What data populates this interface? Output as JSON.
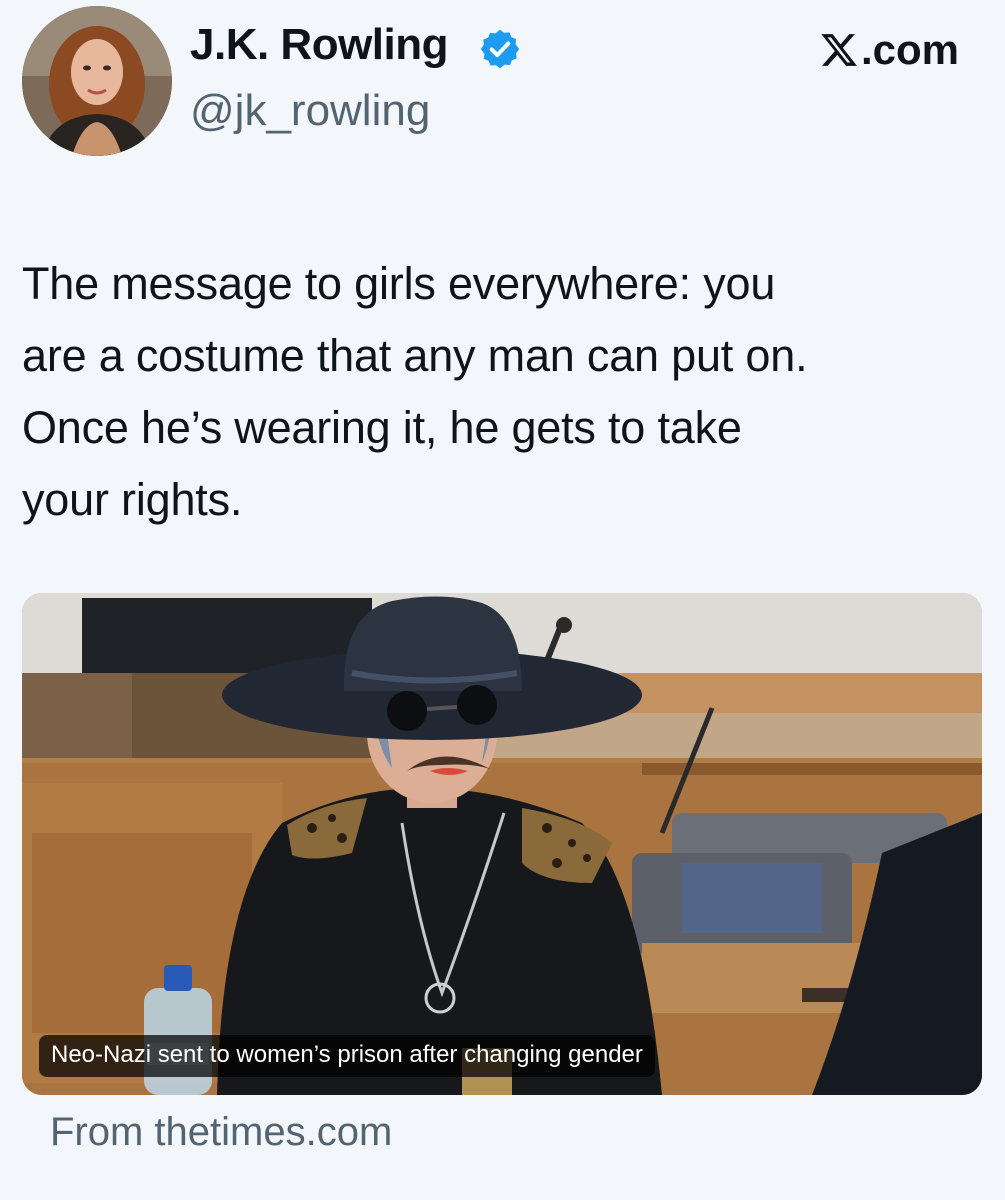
{
  "platform": {
    "label": ".com",
    "icon": "x-logo-icon"
  },
  "author": {
    "display_name": "J.K. Rowling",
    "handle": "@jk_rowling",
    "verified": true,
    "verified_color": "#1d9bf0",
    "avatar_icon": "avatar-photo"
  },
  "tweet": {
    "lines": [
      "The message to girls everywhere: you",
      "are a costume that any man can put on.",
      "Once he’s wearing it, he gets to take",
      "your rights."
    ]
  },
  "media": {
    "caption": "Neo-Nazi sent to women’s prison after changing gender",
    "source": "From thetimes.com"
  },
  "colors": {
    "background": "#f3f7fc",
    "text": "#0f1419",
    "secondary_text": "#536471"
  }
}
